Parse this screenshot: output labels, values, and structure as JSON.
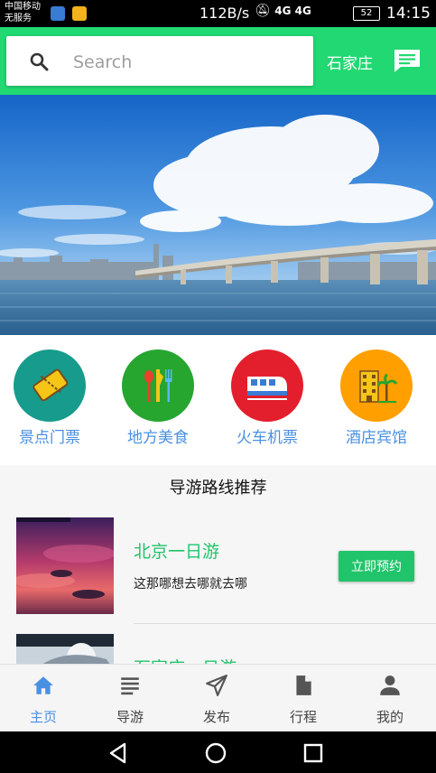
{
  "status_bar": {
    "carrier_line1": "中国移动",
    "carrier_line2": "无服务",
    "net_speed": "112B/s",
    "signal_text": "4G 4G",
    "battery": "52",
    "time": "14:15"
  },
  "header": {
    "search_placeholder": "Search",
    "city": "石家庄",
    "accent_color": "#21d873"
  },
  "categories": [
    {
      "label": "景点门票",
      "icon": "ticket-icon",
      "color": "#169b8c"
    },
    {
      "label": "地方美食",
      "icon": "cutlery-icon",
      "color": "#26a52f"
    },
    {
      "label": "火车机票",
      "icon": "train-icon",
      "color": "#e31e2d"
    },
    {
      "label": "酒店宾馆",
      "icon": "hotel-icon",
      "color": "#ff9f00"
    }
  ],
  "section": {
    "title": "导游路线推荐",
    "routes": [
      {
        "name": "北京一日游",
        "desc": "这那哪想去哪就去哪",
        "button": "立即预约"
      },
      {
        "name": "石家庄一日游",
        "desc": "",
        "button": ""
      }
    ]
  },
  "bottom_nav": [
    {
      "label": "主页",
      "icon": "home-icon",
      "active": true
    },
    {
      "label": "导游",
      "icon": "list-icon",
      "active": false
    },
    {
      "label": "发布",
      "icon": "send-icon",
      "active": false
    },
    {
      "label": "行程",
      "icon": "document-icon",
      "active": false
    },
    {
      "label": "我的",
      "icon": "person-icon",
      "active": false
    }
  ],
  "system_nav": [
    "back-icon",
    "home-circle-icon",
    "recents-icon"
  ]
}
